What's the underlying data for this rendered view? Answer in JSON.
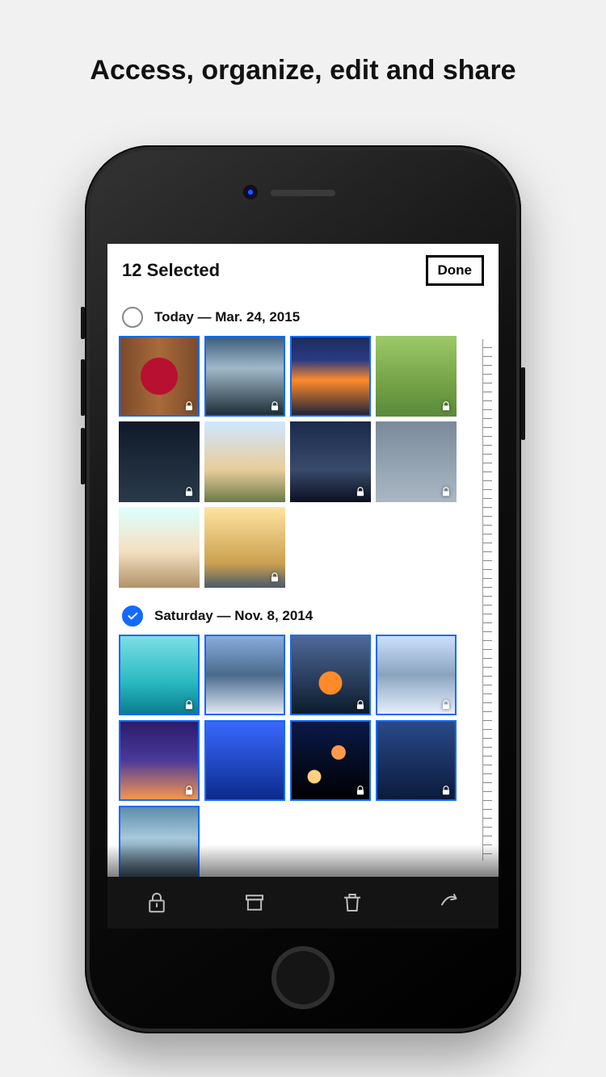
{
  "promo": {
    "headline": "Access, organize, edit and share"
  },
  "header": {
    "title": "12 Selected",
    "done_label": "Done"
  },
  "sections": [
    {
      "checked": false,
      "label": "Today — Mar. 24, 2015",
      "thumbs": [
        {
          "bg": "wreath",
          "selected": true,
          "locked": true
        },
        {
          "bg": "falls",
          "selected": true,
          "locked": true
        },
        {
          "bg": "bridge",
          "selected": true,
          "locked": false
        },
        {
          "bg": "couple",
          "selected": false,
          "locked": true
        },
        {
          "bg": "dome",
          "selected": false,
          "locked": true
        },
        {
          "bg": "kids",
          "selected": false,
          "locked": false
        },
        {
          "bg": "mtn2",
          "selected": false,
          "locked": true
        },
        {
          "bg": "rain",
          "selected": false,
          "locked": true
        },
        {
          "bg": "suitcase",
          "selected": false,
          "locked": false
        },
        {
          "bg": "teddy",
          "selected": false,
          "locked": true
        }
      ]
    },
    {
      "checked": true,
      "label": "Saturday — Nov. 8, 2014",
      "thumbs": [
        {
          "bg": "cabin",
          "selected": true,
          "locked": true
        },
        {
          "bg": "ridge",
          "selected": true,
          "locked": false
        },
        {
          "bg": "camp",
          "selected": true,
          "locked": true
        },
        {
          "bg": "matter",
          "selected": true,
          "locked": true
        },
        {
          "bg": "milky",
          "selected": true,
          "locked": true
        },
        {
          "bg": "blue",
          "selected": true,
          "locked": false
        },
        {
          "bg": "bokeh",
          "selected": true,
          "locked": true
        },
        {
          "bg": "glass",
          "selected": true,
          "locked": true
        },
        {
          "bg": "falls2",
          "selected": true,
          "locked": false
        }
      ]
    }
  ],
  "toolbar": {
    "icons": [
      "lock-icon",
      "archive-icon",
      "trash-icon",
      "share-icon"
    ]
  }
}
